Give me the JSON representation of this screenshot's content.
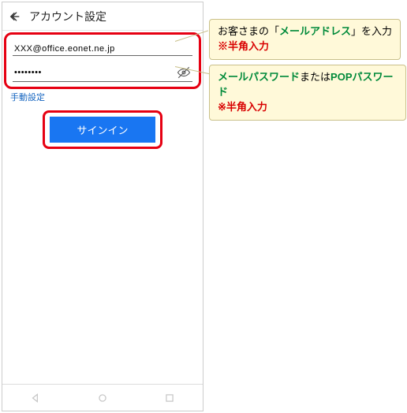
{
  "titlebar": {
    "title": "アカウント設定"
  },
  "form": {
    "email_value": "XXX@office.eonet.ne.jp",
    "password_value": "••••••••",
    "manual_link": "手動設定",
    "signin_label": "サインイン"
  },
  "callouts": {
    "c1_part1": "お客さまの「",
    "c1_green": "メールアドレス",
    "c1_part2": "」を入力",
    "c1_note": "※半角入力",
    "c2_green1": "メールパスワード",
    "c2_mid": "または",
    "c2_green2": "POPパスワード",
    "c2_note": "※半角入力"
  },
  "nav": {
    "back": "back-nav",
    "home": "home-nav",
    "recent": "recent-nav"
  }
}
